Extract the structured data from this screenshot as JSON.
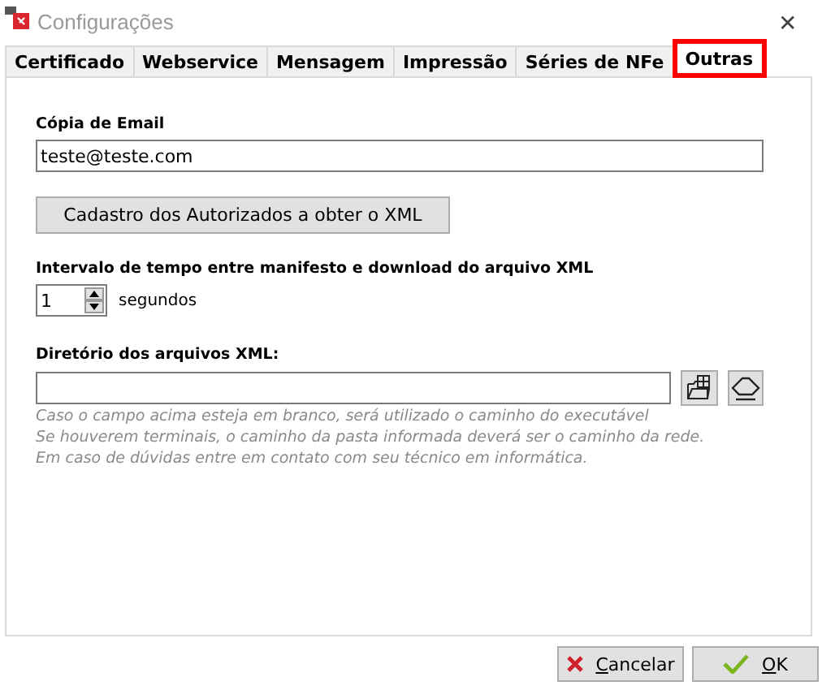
{
  "window": {
    "title": "Configurações",
    "close": "✕"
  },
  "tabs": [
    {
      "label": "Certificado",
      "selected": false
    },
    {
      "label": "Webservice",
      "selected": false
    },
    {
      "label": "Mensagem",
      "selected": false
    },
    {
      "label": "Impressão",
      "selected": false
    },
    {
      "label": "Séries de NFe",
      "selected": false
    },
    {
      "label": "Outras",
      "selected": true
    }
  ],
  "email": {
    "label": "Cópia de  Email",
    "value": "teste@teste.com"
  },
  "authorized_button": "Cadastro dos Autorizados a obter o XML",
  "interval": {
    "label": "Intervalo de tempo entre manifesto e download do arquivo XML",
    "value": "1",
    "unit": "segundos"
  },
  "directory": {
    "label": "Diretório dos arquivos XML:",
    "hints": [
      "Caso o campo acima esteja em branco, será utilizado o caminho do executável",
      "Se houverem terminais, o caminho da pasta informada deverá ser o caminho da rede.",
      "Em caso de dúvidas entre em contato com seu técnico em informática."
    ]
  },
  "buttons": [
    {
      "kind": "cancel",
      "mnemonic": "C",
      "rest": "ancelar"
    },
    {
      "kind": "ok",
      "mnemonic": "O",
      "rest": "K"
    }
  ]
}
